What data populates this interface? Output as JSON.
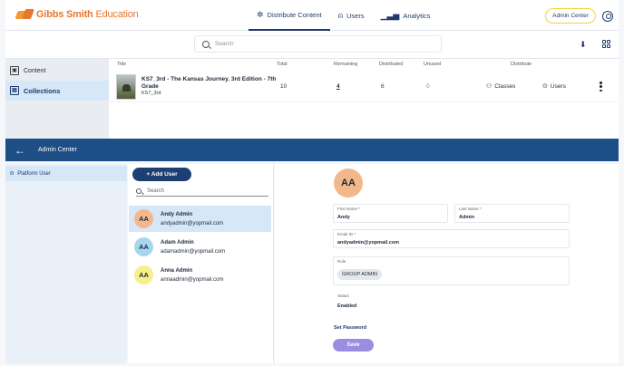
{
  "brand": {
    "name_bold": "Gibbs Smith",
    "name_light": " Education"
  },
  "nav": {
    "tabs": [
      {
        "label": "Distribute Content",
        "icon": "asterisk-icon",
        "active": true
      },
      {
        "label": "Users",
        "icon": "user-icon",
        "active": false
      },
      {
        "label": "Analytics",
        "icon": "bar-chart-icon",
        "active": false
      }
    ],
    "admin_center_label": "Admin Center"
  },
  "search": {
    "placeholder": "Search"
  },
  "library": {
    "items": [
      {
        "label": "Content",
        "active": false
      },
      {
        "label": "Collections",
        "active": true
      }
    ]
  },
  "table": {
    "headers": [
      "Title",
      "Total",
      "Remaining",
      "Distributed",
      "Unused",
      "Distribute"
    ],
    "rows": [
      {
        "title": "KS7_3rd - The Kansas Journey. 3rd Edition - 7th Grade",
        "code": "KS7_3rd",
        "total": "10",
        "remaining": "4",
        "distributed": "6",
        "unused": "0",
        "distribute_classes": "Classes",
        "distribute_users": "Users"
      }
    ]
  },
  "admin": {
    "title": "Admin Center",
    "side_item": "Platform User",
    "add_user_label": "+ Add User",
    "user_search_placeholder": "Search",
    "users": [
      {
        "initials": "AA",
        "name": "Andy Admin",
        "email": "andyadmin@yopmail.com",
        "color": "#f2b88a",
        "selected": true
      },
      {
        "initials": "AA",
        "name": "Adam Admin",
        "email": "adamadmin@yopmail.com",
        "color": "#a7d6ee",
        "selected": false
      },
      {
        "initials": "AA",
        "name": "Anna Admin",
        "email": "annaadmin@yopmail.com",
        "color": "#f7ef8a",
        "selected": false
      }
    ],
    "detail": {
      "initials": "AA",
      "first_name_label": "First Name *",
      "first_name": "Andy",
      "last_name_label": "Last Name *",
      "last_name": "Admin",
      "email_label": "Email ID *",
      "email": "andyadmin@yopmail.com",
      "role_label": "Role",
      "role": "GROUP ADMIN",
      "status_label": "Status",
      "status": "Enabled",
      "set_password_label": "Set Password",
      "save_label": "Save"
    }
  }
}
